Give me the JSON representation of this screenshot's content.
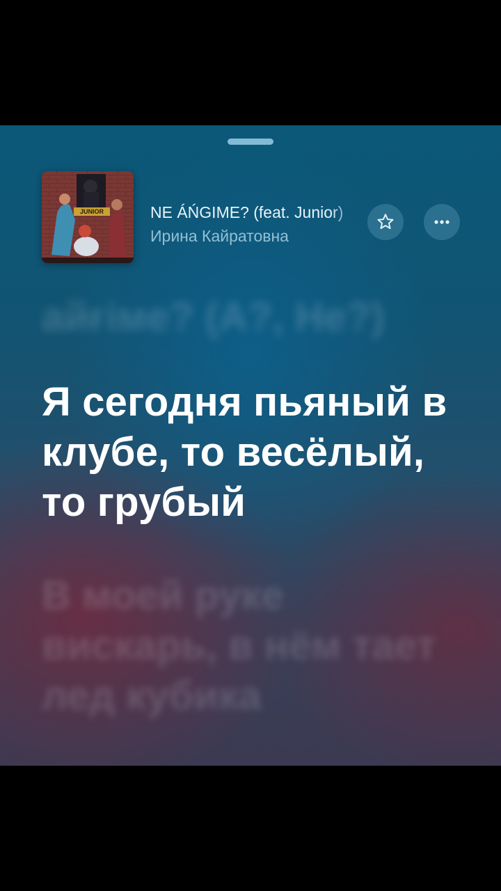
{
  "now_playing": {
    "title": "NE ÁŃGIME? (feat. Junior)",
    "artist": "Ирина Кайратовна",
    "cover_text": "JUNIOR"
  },
  "icons": {
    "favorite": "star-icon",
    "more": "ellipsis-icon"
  },
  "lyrics": {
    "previous": "айғіме? (А?, Не?)",
    "current": "Я сегодня пьяный в клубе, то весёлый, то грубый",
    "next": "В моей руке вискарь, в нём тает лед кубика"
  },
  "colors": {
    "accent_top": "#0b5878",
    "accent_bottom": "#3b3a52",
    "lyric_active": "#ffffff"
  }
}
